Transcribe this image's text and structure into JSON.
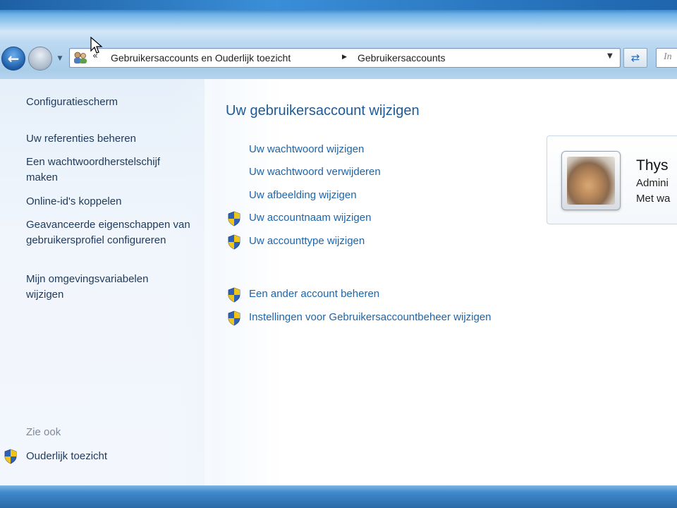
{
  "address_bar": {
    "breadcrumbs": [
      "Gebruikersaccounts en Ouderlijk toezicht",
      "Gebruikersaccounts"
    ],
    "search_placeholder": "In"
  },
  "sidebar": {
    "items": [
      {
        "label": "Configuratiescherm"
      },
      {
        "label": "Uw referenties beheren"
      },
      {
        "label": "Een wachtwoordherstelschijf maken"
      },
      {
        "label": "Online-id's koppelen"
      },
      {
        "label": "Geavanceerde eigenschappen van gebruikersprofiel configureren"
      },
      {
        "label": "Mijn omgevingsvariabelen wijzigen"
      }
    ],
    "see_also_heading": "Zie ook",
    "see_also": [
      {
        "label": "Ouderlijk toezicht",
        "icon": "uac-shield-icon"
      }
    ]
  },
  "main": {
    "title": "Uw gebruikersaccount wijzigen",
    "tasks": [
      {
        "label": "Uw wachtwoord wijzigen",
        "shield": false
      },
      {
        "label": "Uw wachtwoord verwijderen",
        "shield": false
      },
      {
        "label": "Uw afbeelding wijzigen",
        "shield": false
      },
      {
        "label": "Uw accountnaam wijzigen",
        "shield": true
      },
      {
        "label": "Uw accounttype wijzigen",
        "shield": true
      },
      {
        "label": "Een ander account beheren",
        "shield": true
      },
      {
        "label": "Instellingen voor Gebruikersaccountbeheer wijzigen",
        "shield": true
      }
    ]
  },
  "account": {
    "name": "Thys",
    "type": "Admini",
    "status": "Met wa"
  },
  "colors": {
    "link": "#1e64a8",
    "title": "#1e5a96",
    "sidebar_text": "#1e395b",
    "muted": "#7d8a99"
  }
}
